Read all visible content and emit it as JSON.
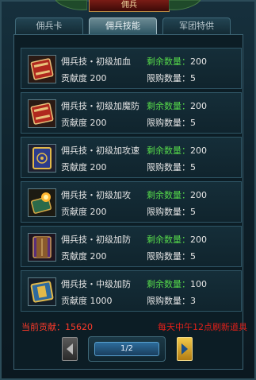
{
  "header": {
    "title": "佣兵"
  },
  "tabs": [
    {
      "label": "佣兵卡"
    },
    {
      "label": "佣兵技能"
    },
    {
      "label": "军团特供"
    }
  ],
  "items": [
    {
      "name": "佣兵技・初级加血",
      "remaining_label": "剩余数量：",
      "remaining": "200",
      "contribution_label": "贡献度",
      "contribution": "200",
      "limit_label": "限购数量：",
      "limit": "5",
      "icon": "red-skill-book-icon"
    },
    {
      "name": "佣兵技・初级加魔防",
      "remaining_label": "剩余数量：",
      "remaining": "200",
      "contribution_label": "贡献度",
      "contribution": "200",
      "limit_label": "限购数量：",
      "limit": "5",
      "icon": "red-skill-book-icon"
    },
    {
      "name": "佣兵技・初级加攻速",
      "remaining_label": "剩余数量：",
      "remaining": "200",
      "contribution_label": "贡献度",
      "contribution": "200",
      "limit_label": "限购数量：",
      "limit": "5",
      "icon": "blue-gold-skill-book-icon"
    },
    {
      "name": "佣兵技・初级加攻",
      "remaining_label": "剩余数量：",
      "remaining": "200",
      "contribution_label": "贡献度",
      "contribution": "200",
      "limit_label": "限购数量：",
      "limit": "5",
      "icon": "fire-skill-book-icon"
    },
    {
      "name": "佣兵技・初级加防",
      "remaining_label": "剩余数量：",
      "remaining": "200",
      "contribution_label": "贡献度",
      "contribution": "200",
      "limit_label": "限购数量：",
      "limit": "5",
      "icon": "purple-skill-book-icon"
    },
    {
      "name": "佣兵技・中级加防",
      "remaining_label": "剩余数量：",
      "remaining": "100",
      "contribution_label": "贡献度",
      "contribution": "1000",
      "limit_label": "限购数量：",
      "limit": "3",
      "icon": "blue-skill-book-icon"
    }
  ],
  "footer": {
    "current_contribution": "当前贡献：15620",
    "refresh_notice": "每天中午12点刷新道具"
  },
  "pager": {
    "page": "1/2"
  },
  "colors": {
    "accent_green": "#55d84a",
    "warning_red": "#e1201a",
    "gold": "#f2c94a"
  }
}
